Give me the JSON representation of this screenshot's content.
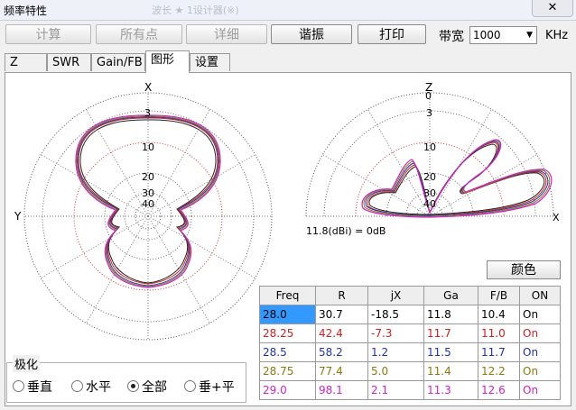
{
  "window": {
    "title": "频率特性",
    "close_glyph": "✕",
    "ghost_title": "波长 ★ 1设计器(※)"
  },
  "toolbar": {
    "buttons": [
      {
        "label": "计算",
        "enabled": false
      },
      {
        "label": "所有点",
        "enabled": false
      },
      {
        "label": "详细",
        "enabled": false
      },
      {
        "label": "谐振",
        "enabled": true
      },
      {
        "label": "打印",
        "enabled": true
      }
    ],
    "bandwidth_label": "带宽",
    "bandwidth_value": "1000",
    "bandwidth_unit": "KHz"
  },
  "tabs": [
    {
      "label": "Z",
      "active": false
    },
    {
      "label": "SWR",
      "active": false
    },
    {
      "label": "Gain/FB",
      "active": false
    },
    {
      "label": "图形",
      "active": true
    },
    {
      "label": "设置",
      "active": false
    }
  ],
  "plots": {
    "horizontal": {
      "top_label": "X",
      "side_label": "Y",
      "ring_labels": [
        "3",
        "10",
        "20",
        "30",
        "40"
      ]
    },
    "vertical": {
      "top_label": "Z",
      "zero_label": "0",
      "ring_labels": [
        "3",
        "10",
        "20",
        "30",
        "40"
      ],
      "ref_note": "11.8(dBi) = 0dB",
      "side_label": "X"
    }
  },
  "polarization": {
    "group_label": "极化",
    "options": [
      {
        "label": "垂直",
        "selected": false
      },
      {
        "label": "水平",
        "selected": false
      },
      {
        "label": "全部",
        "selected": true
      },
      {
        "label": "垂+平",
        "selected": false
      }
    ]
  },
  "color_button": "颜色",
  "results": {
    "headers": [
      "Freq",
      "R",
      "jX",
      "Ga",
      "F/B",
      "ON"
    ],
    "rows": [
      {
        "cells": [
          "28.0",
          "30.7",
          "-18.5",
          "11.8",
          "10.4",
          "On"
        ],
        "color": "#000000",
        "selected": true
      },
      {
        "cells": [
          "28.25",
          "42.4",
          "-7.3",
          "11.7",
          "11.0",
          "On"
        ],
        "color": "#cc2222",
        "selected": false
      },
      {
        "cells": [
          "28.5",
          "58.2",
          "1.2",
          "11.5",
          "11.7",
          "On"
        ],
        "color": "#2233aa",
        "selected": false
      },
      {
        "cells": [
          "28.75",
          "77.4",
          "5.0",
          "11.4",
          "12.2",
          "On"
        ],
        "color": "#8a7a10",
        "selected": false
      },
      {
        "cells": [
          "29.0",
          "98.1",
          "2.1",
          "11.3",
          "12.6",
          "On"
        ],
        "color": "#cc22cc",
        "selected": false
      }
    ]
  },
  "colors": {
    "selected_cell": "#3399ff",
    "outer_ring": "#444444",
    "inner_ring": "#dd3333"
  }
}
